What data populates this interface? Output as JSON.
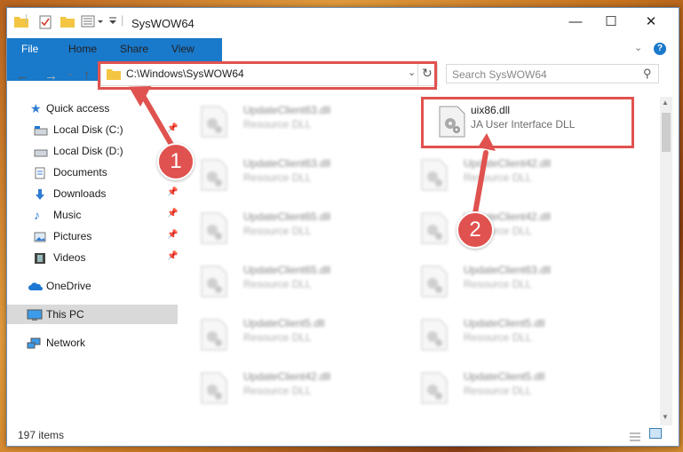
{
  "window": {
    "title": "SysWOW64"
  },
  "ribbon": {
    "tabs": [
      {
        "label": "File"
      },
      {
        "label": "Home"
      },
      {
        "label": "Share"
      },
      {
        "label": "View"
      }
    ]
  },
  "address": {
    "path": "C:\\Windows\\SysWOW64"
  },
  "search": {
    "placeholder": "Search SysWOW64"
  },
  "sidebar": {
    "items": [
      {
        "label": "Quick access"
      },
      {
        "label": "Local Disk (C:)"
      },
      {
        "label": "Local Disk (D:)"
      },
      {
        "label": "Documents"
      },
      {
        "label": "Downloads"
      },
      {
        "label": "Music"
      },
      {
        "label": "Pictures"
      },
      {
        "label": "Videos"
      },
      {
        "label": "OneDrive"
      },
      {
        "label": "This PC"
      },
      {
        "label": "Network"
      }
    ]
  },
  "files": {
    "highlighted": {
      "name": "uix86.dll",
      "type": "JA User Interface DLL"
    },
    "left": [
      {
        "name": "UpdateClient63.dll",
        "type": "Resource DLL"
      },
      {
        "name": "UpdateClient63.dll",
        "type": "Resource DLL"
      },
      {
        "name": "UpdateClient65.dll",
        "type": "Resource DLL"
      },
      {
        "name": "UpdateClient65.dll",
        "type": "Resource DLL"
      },
      {
        "name": "UpdateClient5.dll",
        "type": "Resource DLL"
      },
      {
        "name": "UpdateClient42.dll",
        "type": "Resource DLL"
      }
    ],
    "right": [
      {
        "name": "UpdateClient42.dll",
        "type": "Resource DLL"
      },
      {
        "name": "UpdateClient42.dll",
        "type": "Resource DLL"
      },
      {
        "name": "UpdateClient63.dll",
        "type": "Resource DLL"
      },
      {
        "name": "UpdateClient5.dll",
        "type": "Resource DLL"
      },
      {
        "name": "UpdateClient5.dll",
        "type": "Resource DLL"
      }
    ]
  },
  "status": {
    "count": "197 items"
  },
  "annotations": {
    "step1": "1",
    "step2": "2"
  },
  "colors": {
    "accent": "#1979ca",
    "highlight": "#e0524f"
  }
}
